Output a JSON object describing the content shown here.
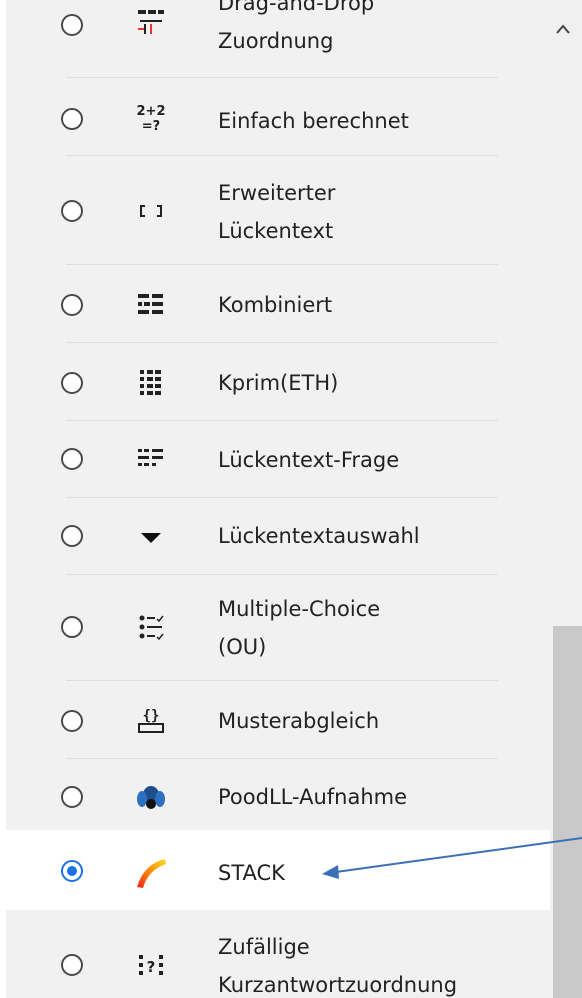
{
  "question_types": [
    {
      "label_lines": [
        "Drag-and-Drop",
        "Zuordnung"
      ],
      "icon": "dragdrop-matching-icon",
      "selected": false
    },
    {
      "label_lines": [
        "Einfach berechnet"
      ],
      "icon": "calculated-simple-icon",
      "selected": false
    },
    {
      "label_lines": [
        "Erweiterter",
        "Lückentext"
      ],
      "icon": "cloze-bracket-icon",
      "selected": false
    },
    {
      "label_lines": [
        "Kombiniert"
      ],
      "icon": "combined-icon",
      "selected": false
    },
    {
      "label_lines": [
        "Kprim(ETH)"
      ],
      "icon": "kprim-grid-icon",
      "selected": false
    },
    {
      "label_lines": [
        "Lückentext-Frage"
      ],
      "icon": "gapfill-icon",
      "selected": false
    },
    {
      "label_lines": [
        "Lückentextauswahl"
      ],
      "icon": "dropdown-triangle-icon",
      "selected": false
    },
    {
      "label_lines": [
        "Multiple-Choice",
        "(OU)"
      ],
      "icon": "multichoice-list-icon",
      "selected": false
    },
    {
      "label_lines": [
        "Musterabgleich"
      ],
      "icon": "pattern-match-icon",
      "selected": false
    },
    {
      "label_lines": [
        "PoodLL-Aufnahme"
      ],
      "icon": "poodll-dog-icon",
      "selected": false
    },
    {
      "label_lines": [
        "STACK"
      ],
      "icon": "stack-rainbow-icon",
      "selected": true
    },
    {
      "label_lines": [
        "Zufällige",
        "Kurzantwortzuordnung"
      ],
      "icon": "random-shortanswer-icon",
      "selected": false
    }
  ],
  "colors": {
    "selected_radio": "#1a73e8",
    "arrow": "#3b6fb6"
  }
}
